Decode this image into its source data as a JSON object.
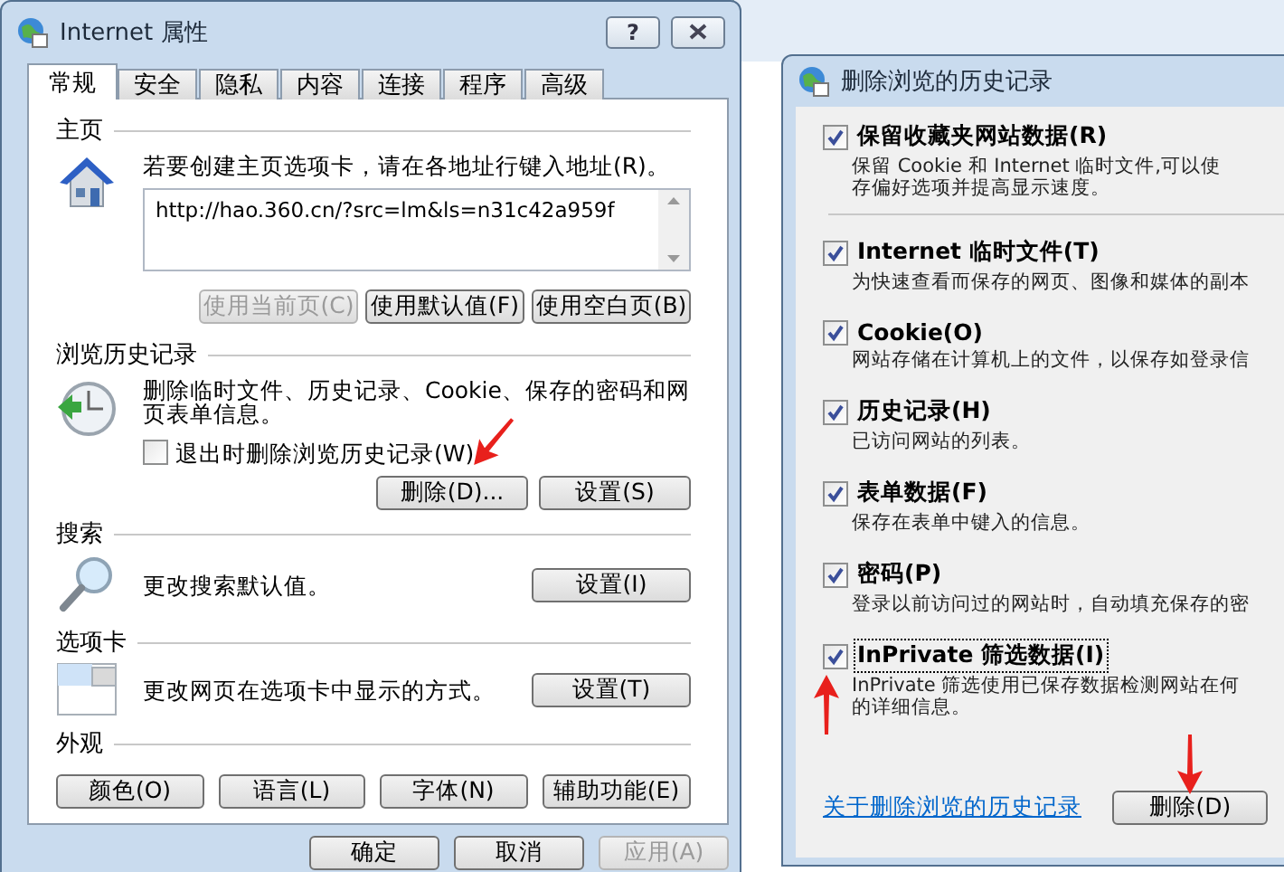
{
  "main_dialog": {
    "title": "Internet 属性",
    "help_button": "?",
    "tabs": [
      {
        "label": "常规",
        "selected": true
      },
      {
        "label": "安全",
        "selected": false
      },
      {
        "label": "隐私",
        "selected": false
      },
      {
        "label": "内容",
        "selected": false
      },
      {
        "label": "连接",
        "selected": false
      },
      {
        "label": "程序",
        "selected": false
      },
      {
        "label": "高级",
        "selected": false
      }
    ],
    "home_page": {
      "heading": "主页",
      "description": "若要创建主页选项卡，请在各地址行键入地址(R)。",
      "address": "http://hao.360.cn/?src=lm&ls=n31c42a959f",
      "buttons": [
        {
          "label": "使用当前页(C)",
          "disabled": true
        },
        {
          "label": "使用默认值(F)",
          "disabled": false
        },
        {
          "label": "使用空白页(B)",
          "disabled": false
        }
      ]
    },
    "browsing_history": {
      "heading": "浏览历史记录",
      "description": "删除临时文件、历史记录、Cookie、保存的密码和网页表单信息。",
      "delete_on_exit": {
        "label": "退出时删除浏览历史记录(W)",
        "checked": false
      },
      "buttons": [
        {
          "label": "删除(D)...",
          "disabled": false
        },
        {
          "label": "设置(S)",
          "disabled": false
        }
      ]
    },
    "search": {
      "heading": "搜索",
      "description": "更改搜索默认值。",
      "button": "设置(I)"
    },
    "tabs_section": {
      "heading": "选项卡",
      "description": "更改网页在选项卡中显示的方式。",
      "button": "设置(T)"
    },
    "appearance": {
      "heading": "外观",
      "buttons": [
        {
          "label": "颜色(O)",
          "disabled": false
        },
        {
          "label": "语言(L)",
          "disabled": false
        },
        {
          "label": "字体(N)",
          "disabled": false
        },
        {
          "label": "辅助功能(E)",
          "disabled": false
        }
      ]
    },
    "footer_buttons": [
      {
        "label": "确定",
        "disabled": false
      },
      {
        "label": "取消",
        "disabled": false
      },
      {
        "label": "应用(A)",
        "disabled": true
      }
    ]
  },
  "delete_dialog": {
    "title": "删除浏览的历史记录",
    "options": [
      {
        "label": "保留收藏夹网站数据(R)",
        "description": [
          "保留 Cookie 和 Internet 临时文件,可以使",
          "存偏好选项并提高显示速度。"
        ],
        "checked": true,
        "focused": false
      },
      {
        "label": "Internet 临时文件(T)",
        "description": [
          "为快速查看而保存的网页、图像和媒体的副本"
        ],
        "checked": true,
        "focused": false
      },
      {
        "label": "Cookie(O)",
        "description": [
          "网站存储在计算机上的文件，以保存如登录信"
        ],
        "checked": true,
        "focused": false
      },
      {
        "label": "历史记录(H)",
        "description": [
          "已访问网站的列表。"
        ],
        "checked": true,
        "focused": false
      },
      {
        "label": "表单数据(F)",
        "description": [
          "保存在表单中键入的信息。"
        ],
        "checked": true,
        "focused": false
      },
      {
        "label": "密码(P)",
        "description": [
          "登录以前访问过的网站时，自动填充保存的密"
        ],
        "checked": true,
        "focused": false
      },
      {
        "label": "InPrivate 筛选数据(I)",
        "description": [
          "InPrivate 筛选使用已保存数据检测网站在何",
          "的详细信息。"
        ],
        "checked": true,
        "focused": true
      }
    ],
    "link": "关于删除浏览的历史记录",
    "delete_button": "删除(D)"
  }
}
